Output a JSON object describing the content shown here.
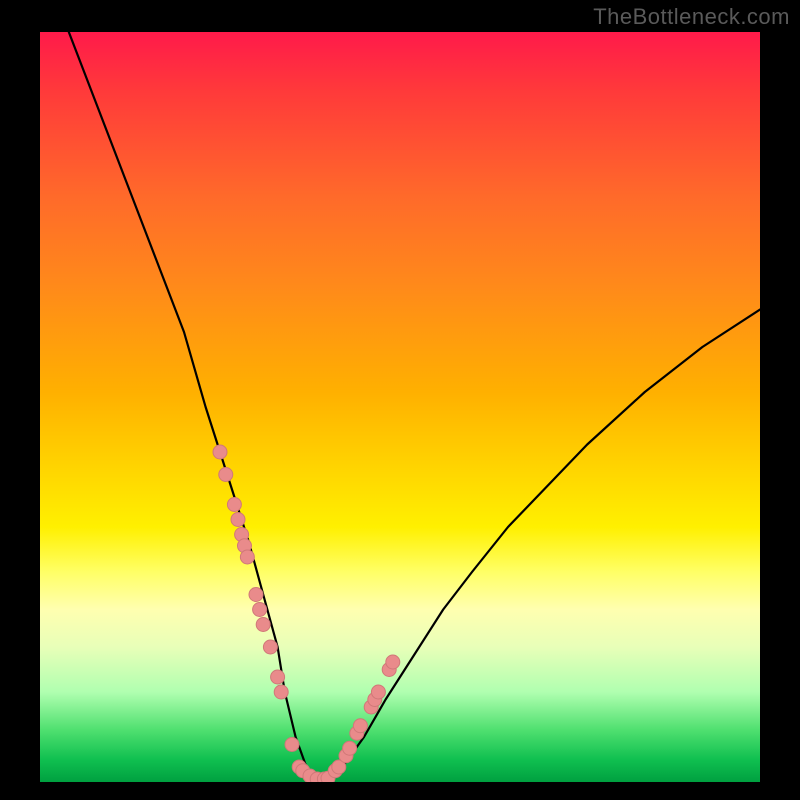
{
  "watermark": "TheBottleneck.com",
  "chart_data": {
    "type": "line",
    "title": "",
    "xlabel": "",
    "ylabel": "",
    "xlim": [
      0,
      100
    ],
    "ylim": [
      0,
      100
    ],
    "series": [
      {
        "name": "bottleneck-curve",
        "x": [
          4,
          8,
          12,
          16,
          20,
          23,
          25,
          27,
          29,
          31,
          33,
          34,
          35.5,
          37,
          38,
          40,
          42,
          45,
          48,
          52,
          56,
          60,
          65,
          70,
          76,
          84,
          92,
          100
        ],
        "y": [
          100,
          90,
          80,
          70,
          60,
          50,
          44,
          38,
          32,
          25,
          18,
          12,
          6,
          2,
          0,
          0,
          2,
          6,
          11,
          17,
          23,
          28,
          34,
          39,
          45,
          52,
          58,
          63
        ]
      }
    ],
    "markers": {
      "name": "sample-points",
      "x": [
        25,
        25.8,
        27,
        27.5,
        28,
        28.4,
        28.8,
        30,
        30.5,
        31,
        32,
        33,
        33.5,
        35,
        36,
        36.5,
        37.5,
        38.5,
        39.5,
        40,
        41,
        41.5,
        42.5,
        43,
        44,
        44.5,
        46,
        46.5,
        47,
        48.5,
        49
      ],
      "y": [
        44,
        41,
        37,
        35,
        33,
        31.5,
        30,
        25,
        23,
        21,
        18,
        14,
        12,
        5,
        2,
        1.5,
        0.8,
        0.4,
        0.4,
        0.5,
        1.5,
        2,
        3.5,
        4.5,
        6.5,
        7.5,
        10,
        11,
        12,
        15,
        16
      ]
    },
    "colors": {
      "curve": "#000000",
      "marker_fill": "#e98b8b",
      "marker_stroke": "#d07878"
    }
  }
}
